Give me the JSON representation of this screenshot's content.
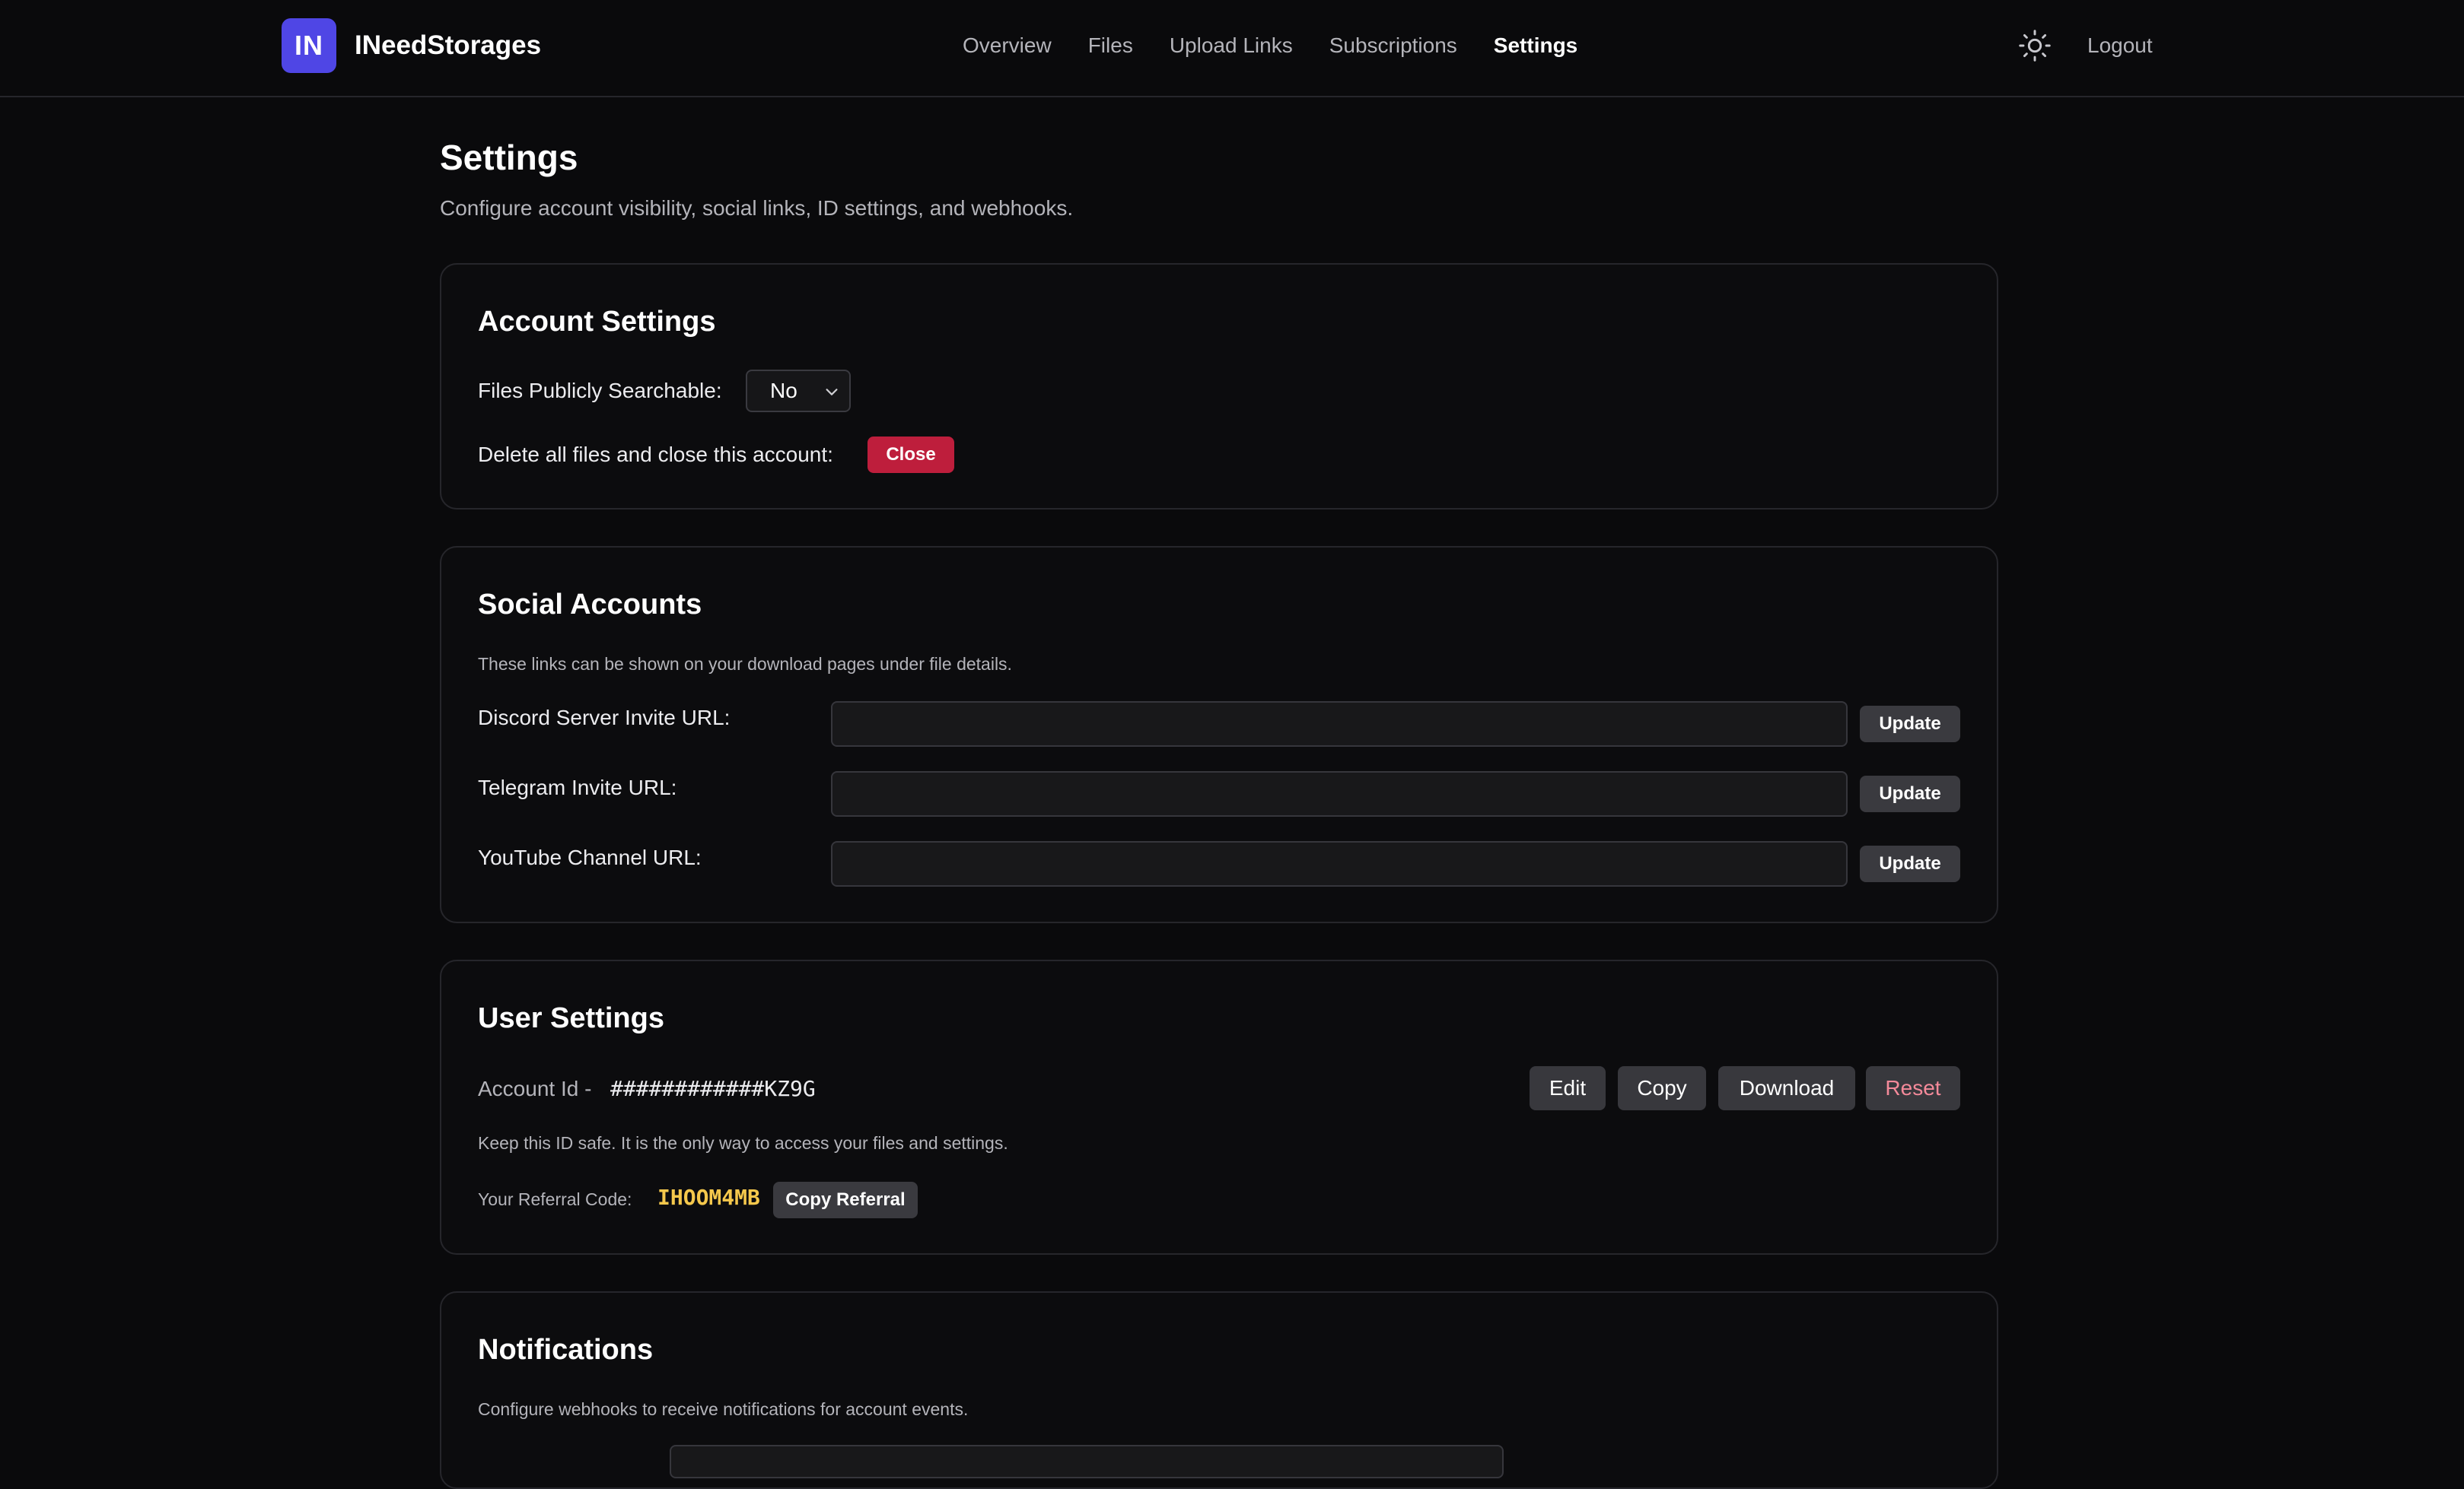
{
  "header": {
    "logo_text": "IN",
    "brand": "INeedStorages",
    "nav": [
      {
        "label": "Overview",
        "active": false
      },
      {
        "label": "Files",
        "active": false
      },
      {
        "label": "Upload Links",
        "active": false
      },
      {
        "label": "Subscriptions",
        "active": false
      },
      {
        "label": "Settings",
        "active": true
      }
    ],
    "theme_icon": "sun-icon",
    "logout_label": "Logout"
  },
  "page": {
    "title": "Settings",
    "subtitle": "Configure account visibility, social links, ID settings, and webhooks."
  },
  "account_settings": {
    "title": "Account Settings",
    "searchable_label": "Files Publicly Searchable:",
    "searchable_value": "No",
    "delete_label": "Delete all files and close this account:",
    "close_label": "Close"
  },
  "social_accounts": {
    "title": "Social Accounts",
    "description": "These links can be shown on your download pages under file details.",
    "fields": [
      {
        "label": "Discord Server Invite URL:",
        "value": "",
        "button": "Update"
      },
      {
        "label": "Telegram Invite URL:",
        "value": "",
        "button": "Update"
      },
      {
        "label": "YouTube Channel URL:",
        "value": "",
        "button": "Update"
      }
    ]
  },
  "user_settings": {
    "title": "User Settings",
    "account_id_label": "Account Id -",
    "account_id_value": "############KZ9G",
    "buttons": {
      "edit": "Edit",
      "copy": "Copy",
      "download": "Download",
      "reset": "Reset"
    },
    "id_note": "Keep this ID safe. It is the only way to access your files and settings.",
    "referral_label": "Your Referral Code:",
    "referral_code": "IHOOM4MB",
    "copy_referral": "Copy Referral"
  },
  "notifications": {
    "title": "Notifications",
    "description": "Configure webhooks to receive notifications for account events."
  },
  "colors": {
    "background": "#0a0a0c",
    "brand_accent": "#4f46e5",
    "danger": "#be1e3c",
    "referral_code": "#f5c84c",
    "reset_text": "#f48a9a"
  }
}
